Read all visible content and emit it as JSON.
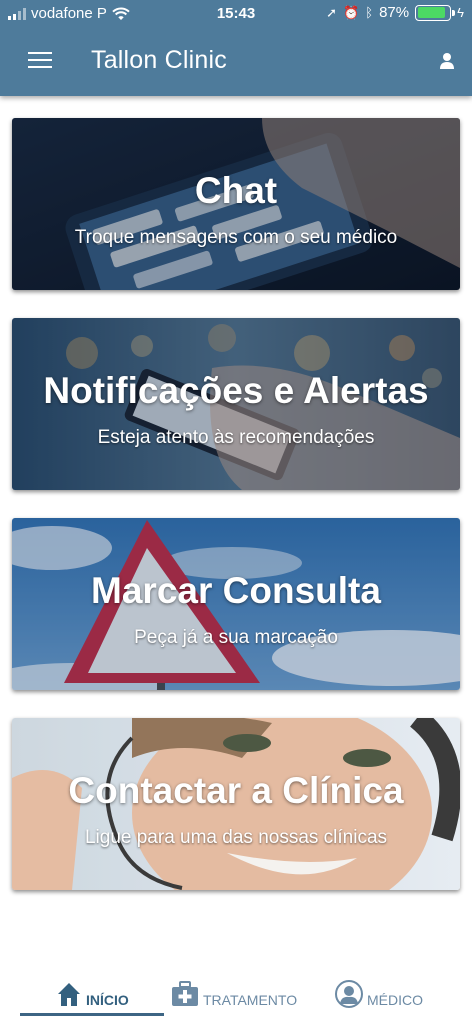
{
  "status_bar": {
    "carrier": "vodafone P",
    "time": "15:43",
    "battery_percent": "87%",
    "battery_level": 0.87
  },
  "header": {
    "title": "Tallon Clinic",
    "menu_icon": "hamburger-menu-icon",
    "user_icon": "user-icon"
  },
  "cards": [
    {
      "title": "Chat",
      "subtitle": "Troque mensagens com o seu médico"
    },
    {
      "title": "Notificações e Alertas",
      "subtitle": "Esteja atento às recomendações"
    },
    {
      "title": "Marcar Consulta",
      "subtitle": "Peça já a sua marcação"
    },
    {
      "title": "Contactar a Clínica",
      "subtitle": "Ligue para uma das nossas clínicas"
    }
  ],
  "tabs": [
    {
      "label": "INÍCIO",
      "icon": "home-icon",
      "active": true
    },
    {
      "label": "TRATAMENTO",
      "icon": "medical-kit-icon",
      "active": false
    },
    {
      "label": "MÉDICO",
      "icon": "doctor-avatar-icon",
      "active": false
    }
  ],
  "colors": {
    "header": "#4e7b9b",
    "tab_active": "#33607f",
    "tab_inactive": "#6c8aa4",
    "battery": "#4cd964"
  }
}
